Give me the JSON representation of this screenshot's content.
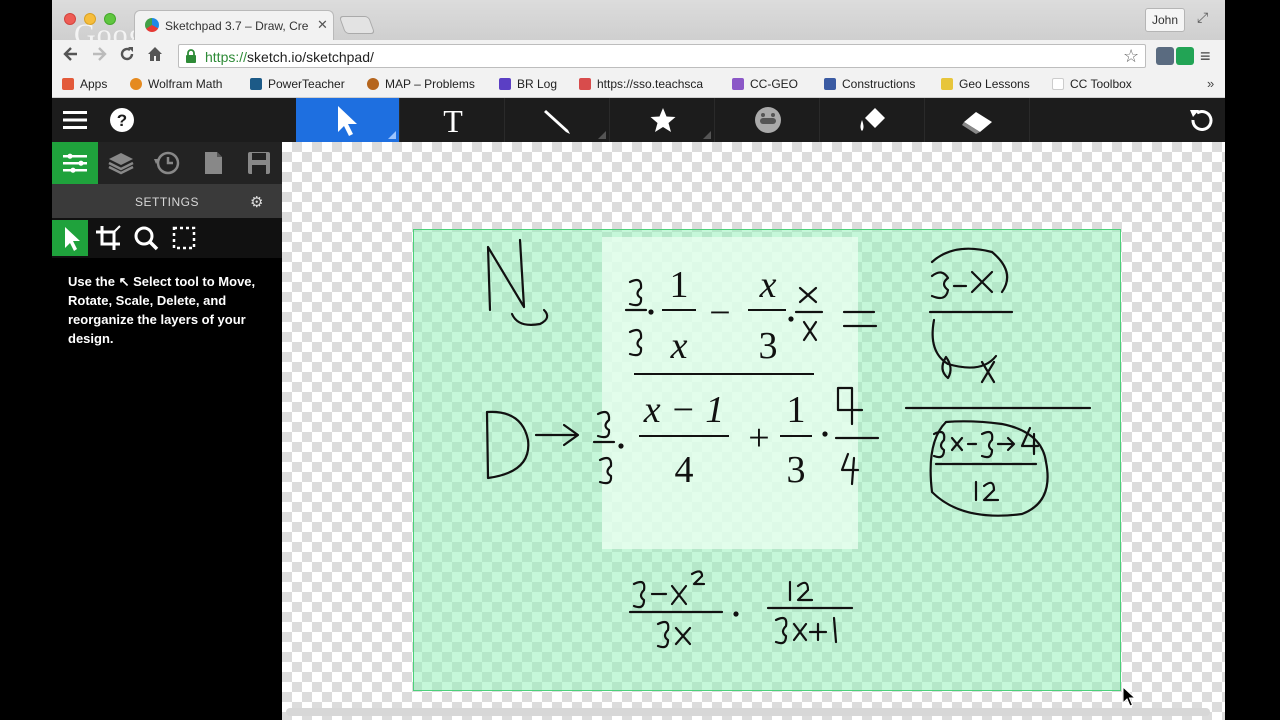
{
  "browser": {
    "tab_title": "Sketchpad 3.7 – Draw, Cre",
    "tab_close": "✕",
    "watermark": "Google",
    "profile": "John",
    "url_scheme": "https://",
    "url_rest": "sketch.io/sketchpad/",
    "bookmarks": [
      {
        "label": "Apps",
        "color": "#e35a3a"
      },
      {
        "label": "Wolfram Math",
        "color": "#e58a1f"
      },
      {
        "label": "PowerTeacher",
        "color": "#1c5a87"
      },
      {
        "label": "MAP – Problems",
        "color": "#b5651d"
      },
      {
        "label": "BR Log",
        "color": "#5b3fc4"
      },
      {
        "label": "https://sso.teachsca",
        "color": "#d84c4c"
      },
      {
        "label": "CC-GEO",
        "color": "#8b57c7"
      },
      {
        "label": "Constructions",
        "color": "#3b5ba3"
      },
      {
        "label": "Geo Lessons",
        "color": "#e7c53b"
      },
      {
        "label": "CC Toolbox",
        "color": "#ffffff"
      }
    ],
    "bookmarks_more": "»"
  },
  "sidebar": {
    "settings_title": "SETTINGS",
    "help_text": "Use the ↖ Select tool to Move, Rotate, Scale, Delete, and reorganize the layers of your design."
  },
  "canvas": {
    "typed_math": {
      "row1": {
        "n1": "1",
        "d1": "x",
        "op": "−",
        "n2": "x",
        "d2": "3"
      },
      "row2": {
        "n1": "x − 1",
        "d1": "4",
        "op": "+",
        "n2": "1",
        "d2": "3"
      }
    }
  },
  "colors": {
    "accent_blue": "#1e6fe0",
    "accent_green": "#1fa23c",
    "selection_green": "#4cd07a"
  }
}
